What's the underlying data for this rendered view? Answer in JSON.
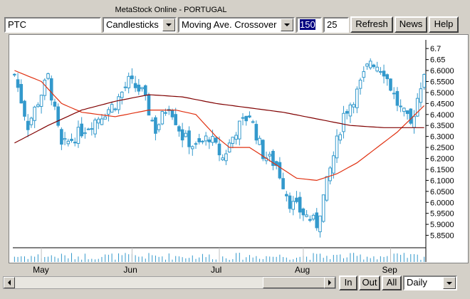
{
  "app": {
    "title": "MetaStock Online - PORTUGAL"
  },
  "toolbar": {
    "symbol_value": "PTC",
    "chart_type_selected": "Candlesticks",
    "indicator_selected": "Moving Ave. Crossover",
    "period_long": "150",
    "period_short": "25",
    "refresh_label": "Refresh",
    "news_label": "News",
    "help_label": "Help"
  },
  "bottom": {
    "zoom_in_label": "In",
    "zoom_out_label": "Out",
    "all_label": "All",
    "interval_selected": "Daily"
  },
  "colors": {
    "candle": "#3399cc",
    "ma_short": "#e03010",
    "ma_long": "#800000",
    "chart_bg": "#ffffff",
    "axis": "#000000"
  },
  "chart_data": {
    "type": "candlestick",
    "title": "",
    "xlabel": "",
    "ylabel": "",
    "ylim": [
      5.8,
      6.72
    ],
    "y_ticks": [
      "6.7",
      "6.65",
      "6.6000",
      "6.5500",
      "6.5000",
      "6.4500",
      "6.4000",
      "6.3500",
      "6.3000",
      "6.2500",
      "6.2000",
      "6.1500",
      "6.1000",
      "6.0500",
      "6.0000",
      "5.9500",
      "5.9000",
      "5.8500"
    ],
    "y_tick_values": [
      6.7,
      6.65,
      6.6,
      6.55,
      6.5,
      6.45,
      6.4,
      6.35,
      6.3,
      6.25,
      6.2,
      6.15,
      6.1,
      6.05,
      6.0,
      5.95,
      5.9,
      5.85
    ],
    "x_month_labels": [
      "May",
      "Jun",
      "Jul",
      "Aug",
      "Sep"
    ],
    "x_month_positions": [
      8,
      35,
      61,
      86,
      112
    ],
    "n_bars": 123,
    "close_anchors": [
      [
        0,
        6.58
      ],
      [
        4,
        6.35
      ],
      [
        10,
        6.57
      ],
      [
        14,
        6.25
      ],
      [
        18,
        6.3
      ],
      [
        22,
        6.35
      ],
      [
        26,
        6.4
      ],
      [
        30,
        6.45
      ],
      [
        34,
        6.55
      ],
      [
        38,
        6.5
      ],
      [
        42,
        6.33
      ],
      [
        46,
        6.45
      ],
      [
        50,
        6.3
      ],
      [
        54,
        6.25
      ],
      [
        58,
        6.3
      ],
      [
        62,
        6.2
      ],
      [
        66,
        6.33
      ],
      [
        70,
        6.4
      ],
      [
        74,
        6.22
      ],
      [
        78,
        6.17
      ],
      [
        82,
        6.0
      ],
      [
        86,
        5.95
      ],
      [
        90,
        5.9
      ],
      [
        94,
        6.15
      ],
      [
        98,
        6.4
      ],
      [
        102,
        6.5
      ],
      [
        106,
        6.65
      ],
      [
        110,
        6.6
      ],
      [
        114,
        6.45
      ],
      [
        118,
        6.35
      ],
      [
        122,
        6.6
      ]
    ],
    "series": [
      {
        "name": "",
        "type": "moving_average",
        "points": [
          [
            0,
            6.6
          ],
          [
            8,
            6.55
          ],
          [
            14,
            6.45
          ],
          [
            20,
            6.41
          ],
          [
            30,
            6.39
          ],
          [
            40,
            6.42
          ],
          [
            48,
            6.42
          ],
          [
            54,
            6.4
          ],
          [
            60,
            6.3
          ],
          [
            64,
            6.25
          ],
          [
            70,
            6.25
          ],
          [
            78,
            6.17
          ],
          [
            84,
            6.11
          ],
          [
            90,
            6.1
          ],
          [
            96,
            6.13
          ],
          [
            102,
            6.18
          ],
          [
            108,
            6.25
          ],
          [
            114,
            6.32
          ],
          [
            118,
            6.38
          ],
          [
            122,
            6.44
          ]
        ]
      },
      {
        "name": "",
        "type": "moving_average",
        "points": [
          [
            0,
            6.27
          ],
          [
            10,
            6.35
          ],
          [
            20,
            6.42
          ],
          [
            30,
            6.46
          ],
          [
            40,
            6.49
          ],
          [
            50,
            6.48
          ],
          [
            60,
            6.45
          ],
          [
            70,
            6.43
          ],
          [
            80,
            6.41
          ],
          [
            90,
            6.38
          ],
          [
            100,
            6.35
          ],
          [
            110,
            6.34
          ],
          [
            122,
            6.34
          ]
        ]
      }
    ]
  }
}
